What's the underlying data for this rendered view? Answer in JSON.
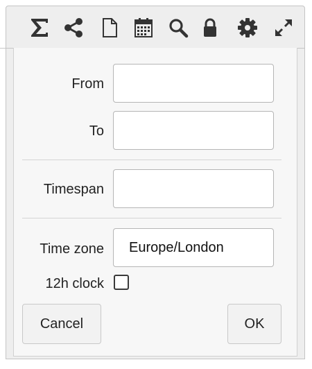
{
  "toolbar": {
    "icons": [
      "sigma-icon",
      "share-icon",
      "document-icon",
      "calendar-icon",
      "search-icon",
      "lock-icon",
      "gear-icon",
      "expand-icon"
    ]
  },
  "form": {
    "from_label": "From",
    "from_value": "",
    "to_label": "To",
    "to_value": "",
    "timespan_label": "Timespan",
    "timespan_value": "",
    "timezone_label": "Time zone",
    "timezone_value": "Europe/London",
    "clock_label": "12h clock",
    "clock_checked": false
  },
  "buttons": {
    "cancel_label": "Cancel",
    "ok_label": "OK"
  },
  "colors": {
    "icon": "#333333",
    "toolbar_bg": "#eeeeee",
    "panel_bg": "#f7f7f7"
  }
}
